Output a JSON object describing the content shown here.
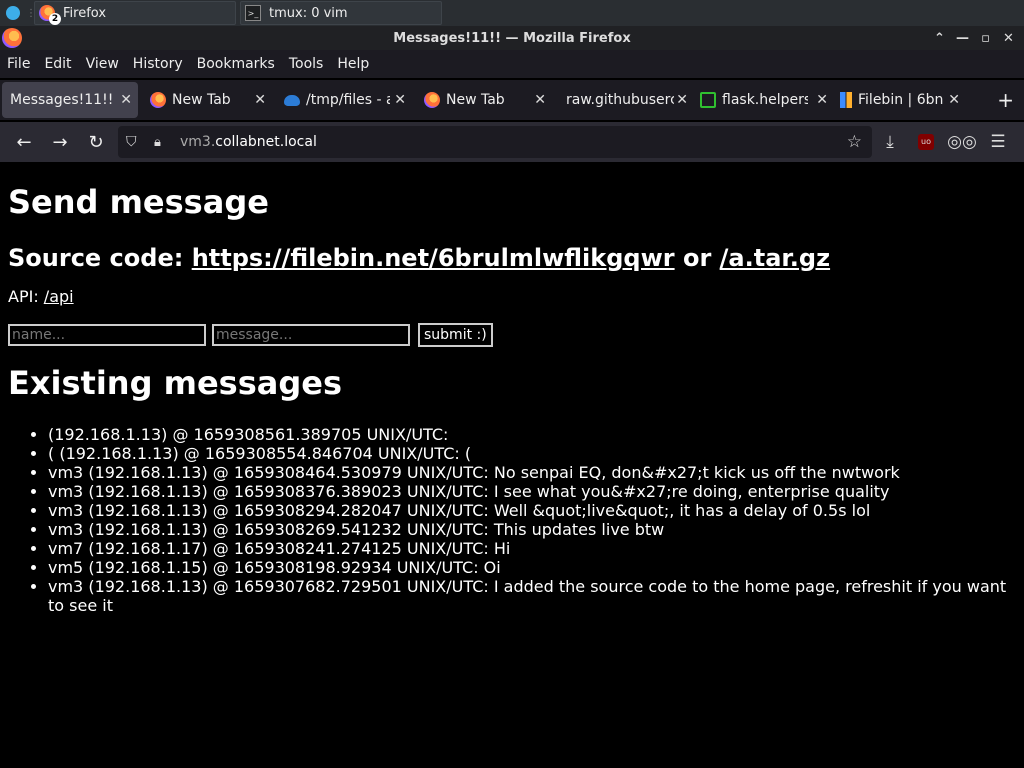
{
  "taskbar": {
    "tasks": [
      {
        "label": "Firefox",
        "badge": "2"
      },
      {
        "label": "tmux: 0 vim"
      }
    ]
  },
  "window": {
    "title": "Messages!11!! — Mozilla Firefox"
  },
  "menu": [
    "File",
    "Edit",
    "View",
    "History",
    "Bookmarks",
    "Tools",
    "Help"
  ],
  "tabs": [
    {
      "label": "Messages!11!!",
      "icon": "none",
      "active": true
    },
    {
      "label": "New Tab",
      "icon": "firefox-icon"
    },
    {
      "label": "/tmp/files - a",
      "icon": "cloud-icon"
    },
    {
      "label": "New Tab",
      "icon": "firefox-icon"
    },
    {
      "label": "raw.githubuserc",
      "icon": "none"
    },
    {
      "label": "flask.helpers",
      "icon": "flask-docs-icon"
    },
    {
      "label": "Filebin | 6bn",
      "icon": "filebin-icon"
    }
  ],
  "nav": {
    "url_prefix": "vm3.",
    "url_host": "collabnet.local"
  },
  "page": {
    "title": "Send message",
    "source_prefix": "Source code: ",
    "source_link1": "https://filebin.net/6brulmlwflikgqwr",
    "source_or": " or ",
    "source_link2": "/a.tar.gz",
    "api_label": "API: ",
    "api_link": "/api",
    "name_placeholder": "name...",
    "message_placeholder": "message...",
    "submit_label": "submit :)",
    "existing_title": "Existing messages",
    "messages": [
      " (192.168.1.13) @ 1659308561.389705 UNIX/UTC: ",
      "( (192.168.1.13) @ 1659308554.846704 UNIX/UTC: (",
      "vm3 (192.168.1.13) @ 1659308464.530979 UNIX/UTC: No senpai EQ, don&#x27;t kick us off the nwtwork",
      "vm3 (192.168.1.13) @ 1659308376.389023 UNIX/UTC: I see what you&#x27;re doing, enterprise quality",
      "vm3 (192.168.1.13) @ 1659308294.282047 UNIX/UTC: Well &quot;live&quot;, it has a delay of 0.5s lol",
      "vm3 (192.168.1.13) @ 1659308269.541232 UNIX/UTC: This updates live btw",
      "vm7 (192.168.1.17) @ 1659308241.274125 UNIX/UTC: Hi",
      "vm5 (192.168.1.15) @ 1659308198.92934 UNIX/UTC: Oi",
      "vm3 (192.168.1.13) @ 1659307682.729501 UNIX/UTC: I added the source code to the home page, refreshit if you want to see it"
    ]
  }
}
